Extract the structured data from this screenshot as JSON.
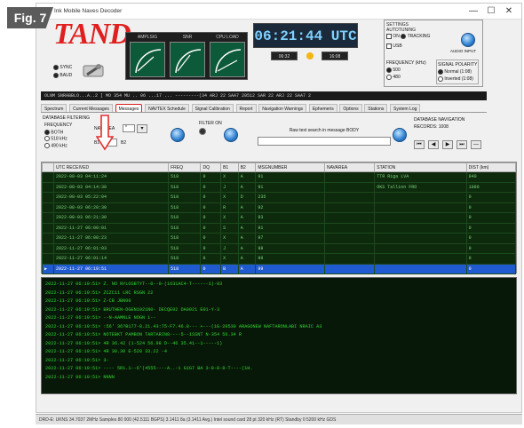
{
  "figure_badge": "Fig. 7",
  "window": {
    "title": "Ink Mobile Naves Decoder",
    "minimize": "—",
    "maximize": "☐",
    "close": "✕"
  },
  "logo": {
    "text": "TAND"
  },
  "mode": {
    "opt1": "SYNC",
    "opt2": "BAUD"
  },
  "meters": [
    {
      "label": "AMPLSIG"
    },
    {
      "label": "SNR"
    },
    {
      "label": "CPU LOAD"
    }
  ],
  "clock": {
    "utc": "06:21:44 UTC",
    "left": "06:32",
    "right": "16:08"
  },
  "settings": {
    "title": "SETTINGS",
    "autotuning": "AUTOTUNING",
    "on": "ON",
    "tracking": "TRACKING",
    "usb": "USB",
    "freq_title": "FREQUENCY (kHz)",
    "f1": "500",
    "f2": "480",
    "polarity_title": "SIGNAL POLARITY",
    "p1": "Normal (1:08)",
    "p2": "Inverted (1:08)",
    "audio_button": "AUDIO INPUT"
  },
  "scroll_text": "OLNM  SNRABBLO...A..2 ]  MO 354 MU ..  06  ...17 ...  ---------(34 ARJ 22 SAA7 20512 SAR 22 ARJ 22 SAA7 2",
  "tabs": [
    {
      "label": "Spectrum",
      "active": false
    },
    {
      "label": "Current Messages",
      "active": false
    },
    {
      "label": "Messages",
      "active": true
    },
    {
      "label": "NAVTEX Schedule",
      "active": false
    },
    {
      "label": "Signal Calibration",
      "active": false
    },
    {
      "label": "Report",
      "active": false
    },
    {
      "label": "Navigation Warnings",
      "active": false
    },
    {
      "label": "Ephemeris",
      "active": false
    },
    {
      "label": "Options",
      "active": false
    },
    {
      "label": "Stations",
      "active": false
    },
    {
      "label": "System Log",
      "active": false
    }
  ],
  "filtering": {
    "title": "DATABASE FILTERING",
    "frequency": "FREQUENCY",
    "f_both": "BOTH",
    "f_518": "518 kHz",
    "f_490": "490 kHz",
    "navarea": "NAVAREA",
    "navarea_val": "*",
    "b1": "B1",
    "b2": "B2",
    "b1_val": "*",
    "filter_on": "FILTER ON",
    "search_label": "Raw text search in message BODY",
    "search_value": "",
    "nav_title": "DATABASE NAVIGATION",
    "nav_records": "RECORDS: 1008",
    "nav_first": "⏮",
    "nav_prev": "◀",
    "nav_next": "▶",
    "nav_last": "⏭",
    "nav_del": "—"
  },
  "table": {
    "columns": [
      "",
      "UTC RECEIVED",
      "FREQ",
      "DQ",
      "B1",
      "B2",
      "MSGNUMBER",
      "NAVAREA",
      "STATION",
      "DIST (km)"
    ],
    "rows": [
      [
        "",
        "2022-08-03 04:11:24",
        "518",
        "0",
        "X",
        "A",
        "91",
        "",
        "TTR Riga LVA",
        "840"
      ],
      [
        "",
        "2022-08-03 04:14:30",
        "518",
        "0",
        "J",
        "A",
        "91",
        "",
        "OKS Tallinn FRO",
        "1080"
      ],
      [
        "",
        "2022-08-03 05:22:04",
        "518",
        "0",
        "X",
        "D",
        "235",
        "",
        "",
        "0"
      ],
      [
        "",
        "2022-08-03 06:20:30",
        "518",
        "0",
        "R",
        "A",
        "92",
        "",
        "",
        "0"
      ],
      [
        "",
        "2022-08-03 06:21:30",
        "518",
        "0",
        "X",
        "A",
        "93",
        "",
        "",
        "0"
      ],
      [
        "",
        "2022-11-27 06:00:01",
        "518",
        "0",
        "S",
        "A",
        "91",
        "",
        "",
        "0"
      ],
      [
        "",
        "2022-11-27 06:00:23",
        "518",
        "0",
        "X",
        "A",
        "97",
        "",
        "",
        "0"
      ],
      [
        "",
        "2022-11-27 06:01:03",
        "518",
        "0",
        "J",
        "A",
        "98",
        "",
        "",
        "0"
      ],
      [
        "",
        "2022-11-27 06:01:14",
        "518",
        "0",
        "X",
        "A",
        "99",
        "",
        "",
        "0"
      ],
      [
        "▶",
        "2022-11-27 06:19:51",
        "518",
        "0",
        "B",
        "A",
        "99",
        "",
        "",
        "0"
      ]
    ],
    "selected_row": 9
  },
  "console_lines": [
    "2022-11-27 06:19:51> Z. NO NYLOSBTYT--0--0-(1631AC4-T------1)-03",
    "2022-11-27 06:19:51> ZCZC11 LRC RSGN 22",
    "2022-11-27 06:19:51> Z-CB JBN00",
    "2022-11-27 06:19:51> BRUTHEN-DGEN1021N0- DECQE02 DA0021 E01-Y-3",
    "2022-11-27 06:19:51> --N-AAMNLE NOGN 1--",
    "2022-11-27 06:19:51> :56' 36?B177-8.21.43:75-F7.46.8--- +---(1G-20530 ARAGONEW NAFTARONLABI NRAIC A3",
    "2022-11-27 06:19:51> NOTEBKT PAMBON TARTARIN8----5--1SSNT N-354 56.34 R",
    "2022-11-27 06:19:51> 4R 36.42 (1-524 56.98 D--46 35.41--1-----1)",
    "2022-11-27 06:19:51> 4R 30.30 E-528 33.22 -4",
    "2022-11-27 06:19:51> 3-",
    "2022-11-27 06:19:51> ---- 5R1.1--6'(4555----A..-1 G1G7 BA 3-8-8-8-T----(1H.",
    "2022-11-27 06:19:51> NNNN"
  ],
  "status_bar": "DRD-E: UKNS 34.7037 2MHz  Samples 80 000 (42.5111 BGPS) 3.1411 8a (3.1411 Avg.)  Intel sound card 28 pt 320 kHz (RT)  Standby 0 5200 kHz  GDS"
}
